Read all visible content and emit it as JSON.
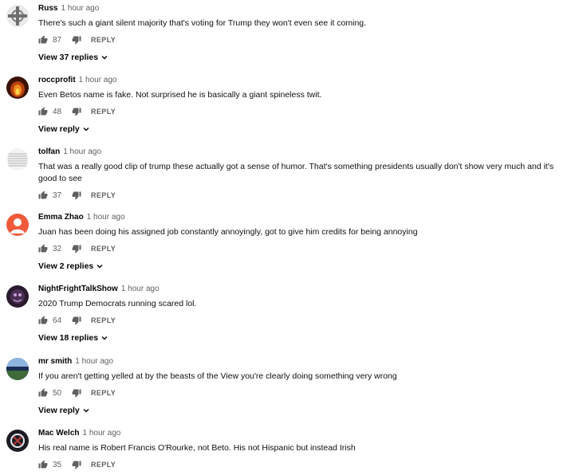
{
  "comments": [
    {
      "author": "Russ",
      "time": "1 hour ago",
      "text": "There's such a giant silent majority that's voting for Trump they won't even see it coming.",
      "likes": "87",
      "reply": "REPLY",
      "view": "View 37 replies",
      "avatar": "celtic-cross"
    },
    {
      "author": "roccprofit",
      "time": "1 hour ago",
      "text": "Even Betos name is fake. Not surprised he is basically a giant spineless twit.",
      "likes": "48",
      "reply": "REPLY",
      "view": "View reply",
      "avatar": "fire-orange"
    },
    {
      "author": "tolfan",
      "time": "1 hour ago",
      "text": "That was a really good clip of trump these actually got a sense of humor. That's something presidents usually don't show very much and it's good to see",
      "likes": "37",
      "reply": "REPLY",
      "view": "",
      "avatar": "text-pattern"
    },
    {
      "author": "Emma Zhao",
      "time": "1 hour ago",
      "text": "Juan has been doing his assigned job constantly annoyingly, got to give him credits for being annoying",
      "likes": "32",
      "reply": "REPLY",
      "view": "View 2 replies",
      "avatar": "default-person"
    },
    {
      "author": "NightFrightTalkShow",
      "time": "1 hour ago",
      "text": "2020 Trump Democrats running scared lol.",
      "likes": "64",
      "reply": "REPLY",
      "view": "View 18 replies",
      "avatar": "dark-purple"
    },
    {
      "author": "mr smith",
      "time": "1 hour ago",
      "text": "If you aren't getting yelled at by the beasts of the View you're clearly doing something very wrong",
      "likes": "50",
      "reply": "REPLY",
      "view": "View reply",
      "avatar": "stadium"
    },
    {
      "author": "Mac Welch",
      "time": "1 hour ago",
      "text": "His real name is Robert Francis O'Rourke, not Beto. His not Hispanic but instead Irish",
      "likes": "35",
      "reply": "REPLY",
      "view": "",
      "avatar": "dark-logo"
    }
  ],
  "colors": {
    "meta": "#606060",
    "text": "#0f0f0f",
    "default_avatar": "#ef5a3a"
  }
}
